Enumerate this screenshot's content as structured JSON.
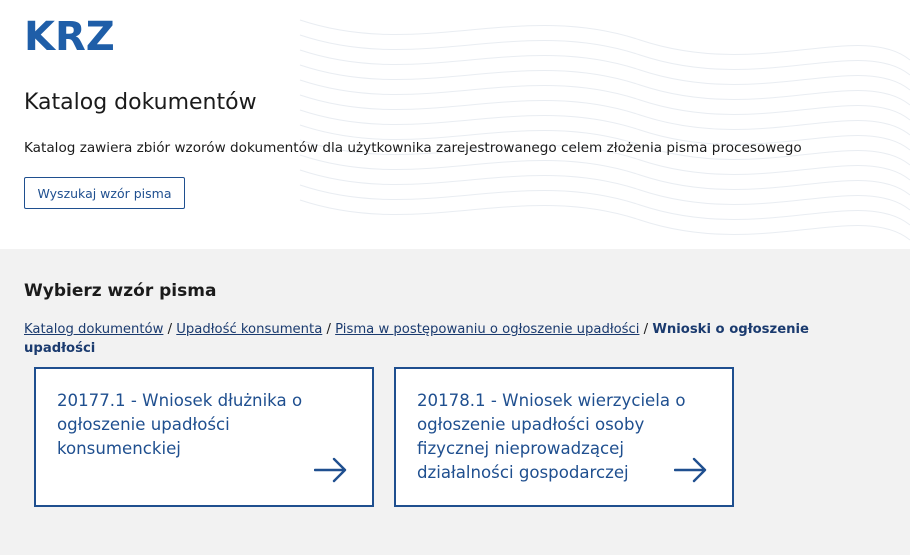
{
  "header": {
    "logo": "KRZ",
    "title": "Katalog dokumentów",
    "description": "Katalog zawiera zbiór wzorów dokumentów dla użytkownika zarejestrowanego celem złożenia pisma procesowego",
    "search_button": "Wyszukaj wzór pisma"
  },
  "main": {
    "heading": "Wybierz wzór pisma",
    "breadcrumb": [
      {
        "label": "Katalog dokumentów",
        "link": true
      },
      {
        "label": "Upadłość konsumenta",
        "link": true
      },
      {
        "label": "Pisma w postępowaniu o ogłoszenie upadłości",
        "link": true
      },
      {
        "label": "Wnioski o ogłoszenie upadłości",
        "link": false
      }
    ],
    "separator": "/",
    "cards": [
      {
        "title": "20177.1 - Wniosek dłużnika o ogłoszenie upadłości konsumenckiej",
        "icon": "arrow-right-icon"
      },
      {
        "title": "20178.1 - Wniosek wierzyciela o ogłoszenie upadłości osoby fizycznej nieprowadzącej działalności gospodarczej",
        "icon": "arrow-right-icon"
      }
    ]
  },
  "colors": {
    "brand": "#1f5ea8",
    "accent": "#1f4f8f",
    "band": "#f2f2f2"
  }
}
